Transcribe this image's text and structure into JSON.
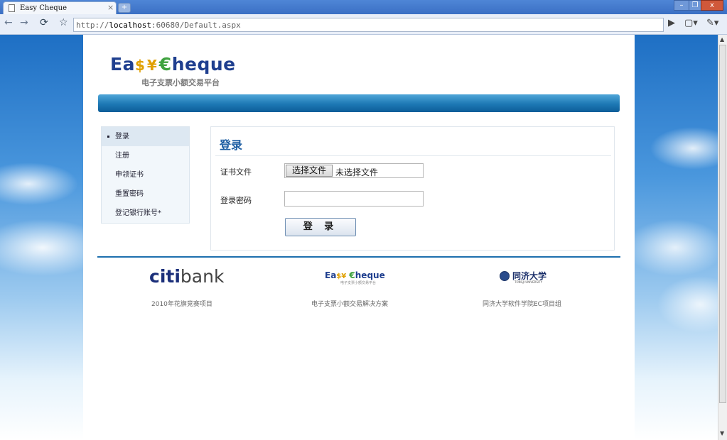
{
  "browser": {
    "tab_title": "Easy Cheque",
    "tab_close": "×",
    "new_tab": "+",
    "url_scheme": "http://",
    "url_host": "localhost",
    "url_rest": ":60680/Default.aspx",
    "window_buttons": {
      "minimize": "–",
      "restore": "❐",
      "close": "x"
    }
  },
  "header": {
    "logo_ea": "Ea",
    "logo_money": "$¥",
    "logo_euro": "€",
    "logo_rest": "heque",
    "subtitle": "电子支票小额交易平台"
  },
  "sidebar": {
    "items": [
      {
        "label": "登录",
        "active": true
      },
      {
        "label": "注册"
      },
      {
        "label": "申领证书"
      },
      {
        "label": "重置密码"
      },
      {
        "label": "登记银行账号*"
      }
    ]
  },
  "login": {
    "title": "登录",
    "cert_label": "证书文件",
    "file_button": "选择文件",
    "file_status": "未选择文件",
    "password_label": "登录密码",
    "password_value": "",
    "submit_label": "登 录"
  },
  "footer": {
    "citi_a": "citi",
    "citi_b": "bank",
    "citi_caption": "2010年花旗竞赛项目",
    "easy_logo_ea": "Ea",
    "easy_logo_money": "$¥",
    "easy_logo_euro": "€",
    "easy_logo_rest": "heque",
    "easy_logo_sub": "电子支票小额交易平台",
    "easy_caption": "电子支票小额交易解决方案",
    "tongji_name": "同济大学",
    "tongji_en": "TONGJI UNIVERSITY",
    "tongji_caption": "同济大学软件学院EC项目组"
  },
  "colors": {
    "accent": "#1f5fa3",
    "banner": "#1d78b4",
    "logo_blue": "#1f3f8f",
    "logo_gold": "#e0a000",
    "logo_green": "#3fa23f"
  }
}
